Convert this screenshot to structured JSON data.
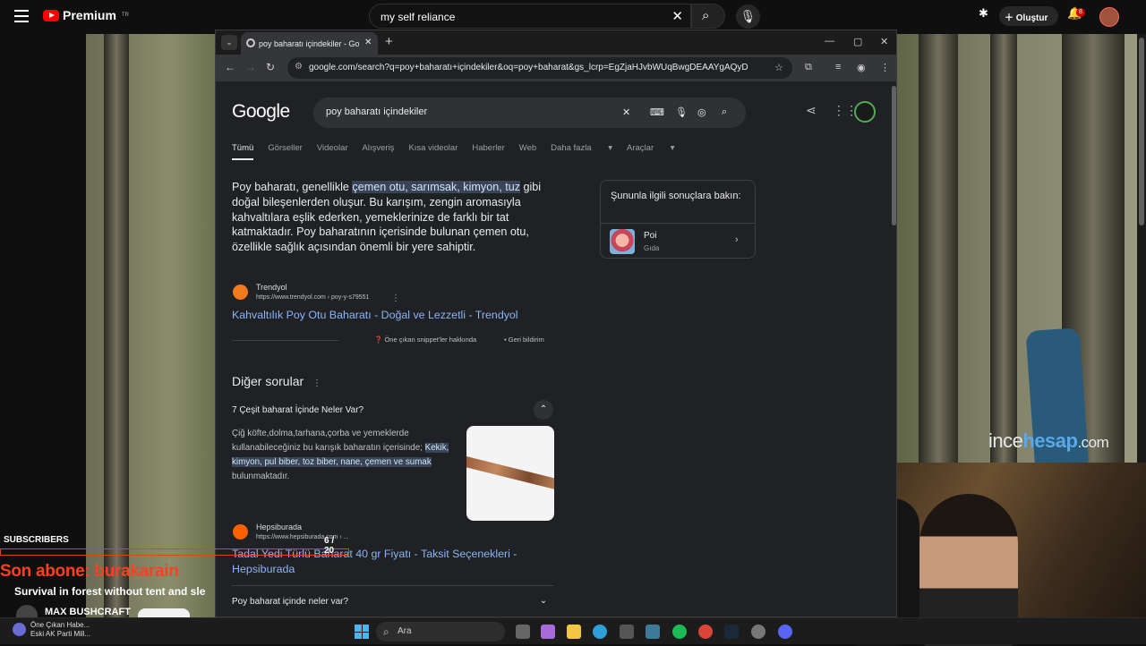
{
  "youtube": {
    "logo_text": "Premium",
    "logo_tr": "TR",
    "search_value": "my self reliance",
    "create_label": "Oluştur",
    "notif_count": "8"
  },
  "tab": {
    "title": "poy baharatı içindekiler - Goog"
  },
  "omnibox": {
    "url": "google.com/search?q=poy+baharatı+içindekiler&oq=poy+baharat&gs_lcrp=EgZjaHJvbWUqBwgDEAAYgAQyDQgAEAAYg..."
  },
  "google": {
    "logo": "Google",
    "query": "poy baharatı içindekiler",
    "tabs": [
      "Tümü",
      "Görseller",
      "Videolar",
      "Alışveriş",
      "Kısa videolar",
      "Haberler",
      "Web",
      "Daha fazla",
      "Araçlar"
    ],
    "snippet_pre": "Poy baharatı, genellikle ",
    "snippet_hl": "çemen otu, sarımsak, kimyon, tuz",
    "snippet_post": " gibi doğal bileşenlerden oluşur. Bu karışım, zengin aromasıyla kahvaltılara eşlik ederken, yemeklerinize de farklı bir tat katmaktadır. Poy baharatının içerisinde bulunan çemen otu, özellikle sağlık açısından önemli bir yere sahiptir.",
    "src1_name": "Trendyol",
    "src1_url": "https://www.trendyol.com › poy-y-s79551",
    "src1_link": "Kahvaltılık Poy Otu Baharatı - Doğal ve Lezzetli - Trendyol",
    "about_snippets": "Öne çıkan snippet'ler hakkında",
    "feedback": "Geri bildirim",
    "paa_title": "Diğer sorular",
    "q1": "7 Çeşit baharat İçinde Neler Var?",
    "ans_pre": "Çiğ köfte,dolma,tarhana,çorba ve yemeklerde kullanabileceğiniz bu karışık baharatın içerisinde;",
    "ans_hl": "Kekik, kimyon, pul biber, toz biber, nane, çemen ve sumak",
    "ans_post": " bulunmaktadır.",
    "src2_name": "Hepsiburada",
    "src2_url": "https://www.hepsiburada.com › ...",
    "src2_link": "Tadal Yedi Türlü Baharat 40 gr Fiyatı - Taksit Seçenekleri - Hepsiburada",
    "q2": "Poy baharat içinde neler var?",
    "side_head": "Şununla ilgili sonuçlara bakın:",
    "side_title": "Poi",
    "side_sub": "Gıda"
  },
  "stream": {
    "brand_a": "ince",
    "brand_b": "hesap",
    "brand_c": ".com",
    "subs_label": "SUBSCRIBERS",
    "subs_count": "6 / 20",
    "last_sub": "Son abone: burakarain",
    "video_title": "Survival in forest without tent and sle",
    "channel": "MAX BUSHCRAFT"
  },
  "taskbar": {
    "news_1": "Öne Çıkan Habe...",
    "news_2": "Eski AK Parti Mill...",
    "search": "Ara"
  }
}
